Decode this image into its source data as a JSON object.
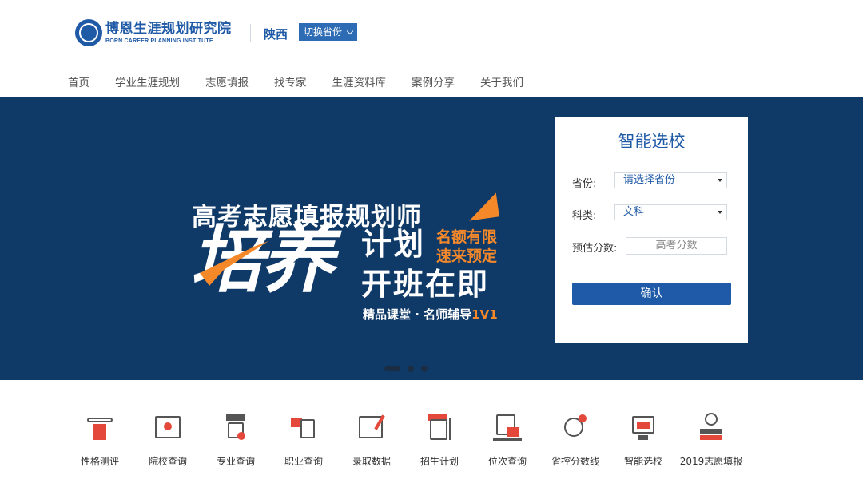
{
  "header": {
    "logo_cn": "博恩生涯规划研究院",
    "logo_en": "BORN CAREER PLANNING INSTITUTE",
    "province": "陕西",
    "switch_label": "切换省份"
  },
  "nav": [
    "首页",
    "学业生涯规划",
    "志愿填报",
    "找专家",
    "生涯资料库",
    "案例分享",
    "关于我们"
  ],
  "banner": {
    "line1": "高考志愿填报规划师",
    "big": "培养",
    "plan": "计划",
    "open": "开班在即",
    "orange1": "名额有限",
    "orange2": "速来预定",
    "sub_main": "精品课堂 · 名师辅导",
    "sub_hl": "1V1",
    "colors": {
      "bg": "#0f3a68",
      "accent": "#f5892a"
    }
  },
  "form": {
    "title": "智能选校",
    "province_label": "省份:",
    "province_value": "请选择省份",
    "subject_label": "科类:",
    "subject_value": "文科",
    "score_label": "预估分数:",
    "score_placeholder": "高考分数",
    "confirm_label": "确认"
  },
  "tools": [
    {
      "label": "性格测评",
      "icon": "personality-test-icon"
    },
    {
      "label": "院校查询",
      "icon": "college-search-icon"
    },
    {
      "label": "专业查询",
      "icon": "major-search-icon"
    },
    {
      "label": "职业查询",
      "icon": "career-search-icon"
    },
    {
      "label": "录取数据",
      "icon": "admission-data-icon"
    },
    {
      "label": "招生计划",
      "icon": "enrollment-plan-icon"
    },
    {
      "label": "位次查询",
      "icon": "rank-search-icon"
    },
    {
      "label": "省控分数线",
      "icon": "score-line-icon"
    },
    {
      "label": "智能选校",
      "icon": "smart-select-icon"
    },
    {
      "label": "2019志愿填报",
      "icon": "application-2019-icon"
    }
  ]
}
